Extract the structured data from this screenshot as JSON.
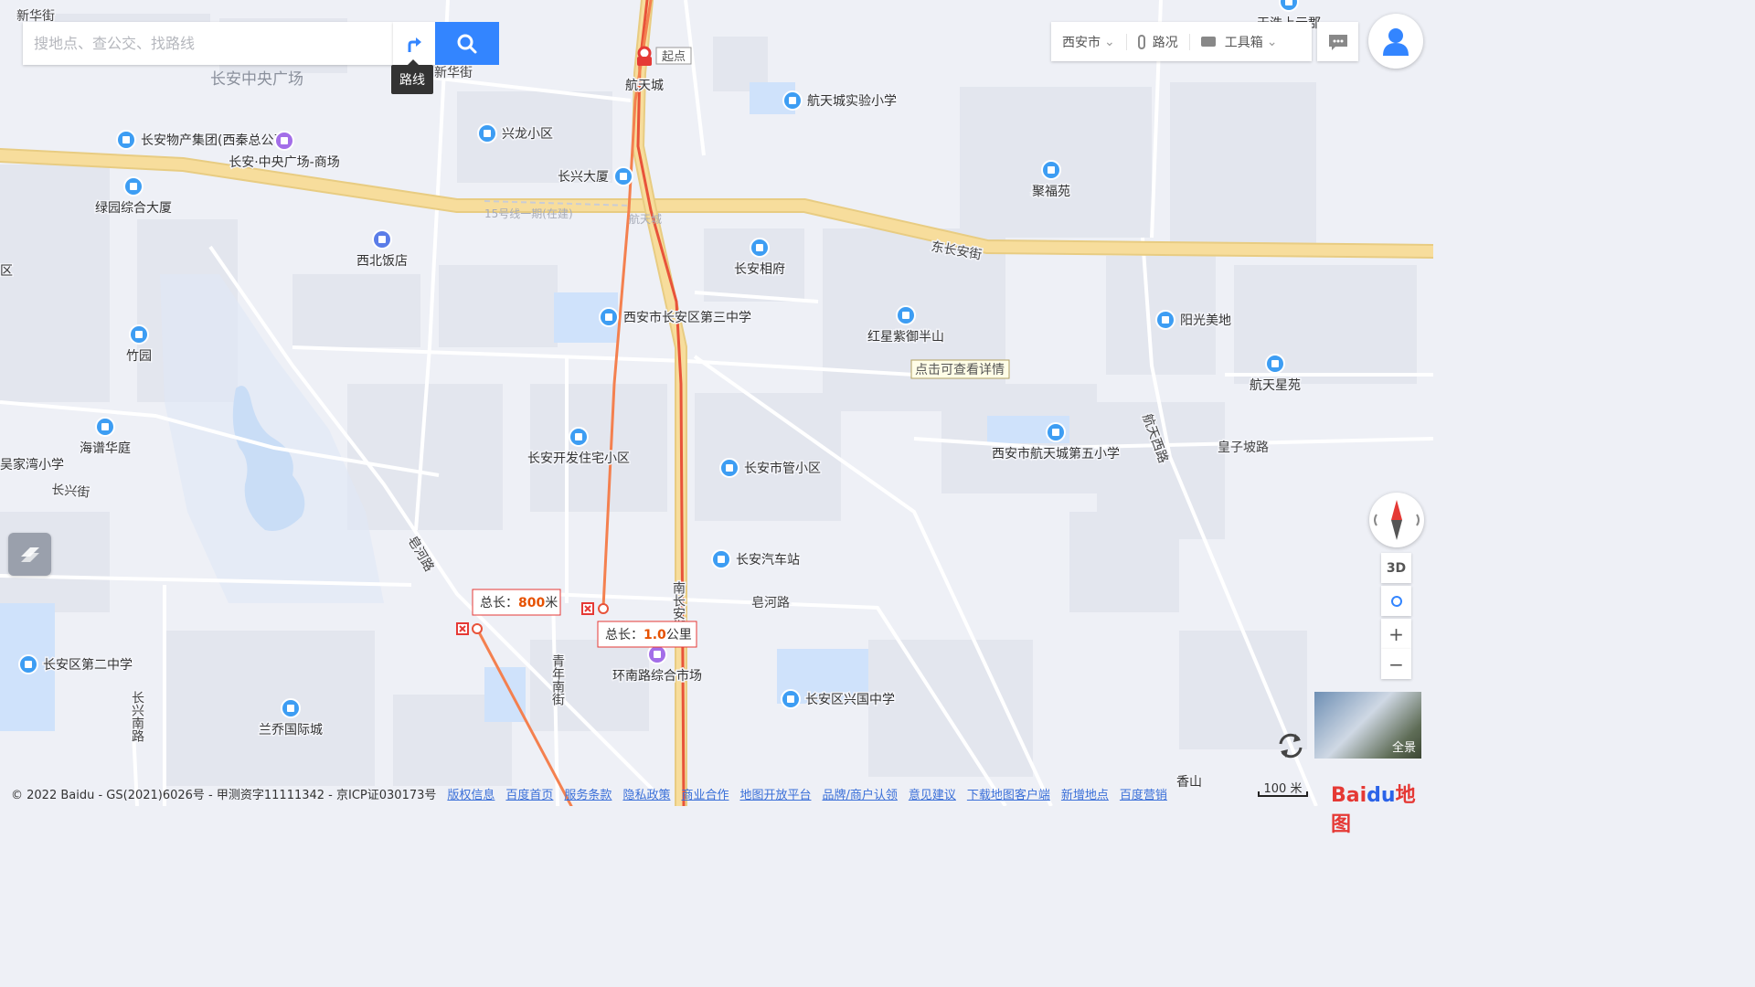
{
  "search": {
    "placeholder": "搜地点、查公交、找路线",
    "route_tooltip": "路线"
  },
  "toolbar": {
    "city": "西安市",
    "traffic": "路况",
    "tools": "工具箱"
  },
  "map": {
    "areas": [
      {
        "name": "长安中央广场"
      }
    ],
    "roads": [
      "新华街",
      "新华街",
      "东长安街",
      "航天西路",
      "皇子坡路",
      "皂河路",
      "皂河路",
      "长兴街",
      "南长安街",
      "青年南街",
      "长兴南路"
    ],
    "metro": {
      "line": "15号线一期(在建)",
      "station": "航天城"
    },
    "pois": [
      {
        "name": "航天城",
        "icon": "metro-icon"
      },
      {
        "name": "航天城实验小学",
        "icon": "school-icon"
      },
      {
        "name": "兴龙小区",
        "icon": "residential-icon"
      },
      {
        "name": "长兴大厦",
        "icon": "building-icon"
      },
      {
        "name": "长安物产集团(西秦总公司)",
        "icon": "building-icon"
      },
      {
        "name": "长安·中央广场-商场",
        "icon": "shopping-icon"
      },
      {
        "name": "绿园综合大厦",
        "icon": "building-icon"
      },
      {
        "name": "西北饭店",
        "icon": "hotel-icon"
      },
      {
        "name": "聚福苑",
        "icon": "residential-icon"
      },
      {
        "name": "长安相府",
        "icon": "residential-icon"
      },
      {
        "name": "西安市长安区第三中学",
        "icon": "school-icon"
      },
      {
        "name": "红星紫御半山",
        "icon": "residential-icon"
      },
      {
        "name": "阳光美地",
        "icon": "residential-icon"
      },
      {
        "name": "航天星苑",
        "icon": "residential-icon"
      },
      {
        "name": "竹园",
        "icon": "residential-icon"
      },
      {
        "name": "海谱华庭",
        "icon": "residential-icon"
      },
      {
        "name": "吴家湾小学",
        "icon": "school-icon"
      },
      {
        "name": "长安开发住宅小区",
        "icon": "residential-icon"
      },
      {
        "name": "长安市管小区",
        "icon": "residential-icon"
      },
      {
        "name": "西安市航天城第五小学",
        "icon": "school-icon"
      },
      {
        "name": "长安汽车站",
        "icon": "bus-icon"
      },
      {
        "name": "环南路综合市场",
        "icon": "shopping-icon"
      },
      {
        "name": "长安区兴国中学",
        "icon": "school-icon"
      },
      {
        "name": "长安区第二中学",
        "icon": "school-icon"
      },
      {
        "name": "兰乔国际城",
        "icon": "residential-icon"
      },
      {
        "name": "天浩上元郡",
        "icon": "residential-icon"
      },
      {
        "name": "香山",
        "icon": "residential-icon"
      }
    ],
    "region_edge": "区",
    "start_label": "起点",
    "detail_hint": "点击可查看详情",
    "measure_1": {
      "prefix": "总长：",
      "value": "800",
      "unit": "米"
    },
    "measure_2": {
      "prefix": "总长：",
      "value": "1.0",
      "unit": "公里"
    }
  },
  "controls": {
    "three_d": "3D",
    "zoom_in": "+",
    "zoom_out": "−",
    "panorama": "全景"
  },
  "scale": "100 米",
  "footer": {
    "copyright": "© 2022 Baidu - GS(2021)6026号 - 甲测资字11111342 - 京ICP证030173号",
    "links": [
      "版权信息",
      "百度首页",
      "服务条款",
      "隐私政策",
      "商业合作",
      "地图开放平台",
      "品牌/商户认领",
      "意见建议",
      "下载地图客户端",
      "新增地点",
      "百度营销"
    ]
  },
  "logo": {
    "bai": "Bai",
    "du": "du",
    "map": "地图"
  },
  "colors": {
    "background": "#eef0f6",
    "block": "#e3e6ee",
    "main_road": "#f7dd9c",
    "water": "#a8ccf5",
    "route_red": "#e8533a",
    "route_orange": "#f4804f",
    "accent_blue": "#3385ff"
  }
}
